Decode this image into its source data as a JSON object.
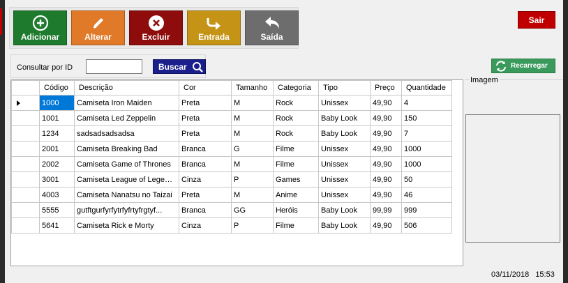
{
  "toolbar": {
    "add_label": "Adicionar",
    "edit_label": "Alterar",
    "delete_label": "Excluir",
    "in_label": "Entrada",
    "out_label": "Saída",
    "exit_label": "Sair"
  },
  "colors": {
    "add": "#1e7b2e",
    "edit": "#e07a28",
    "delete": "#8e0c0c",
    "in": "#c59417",
    "out": "#6d6d6d",
    "exit": "#c00000",
    "search": "#1a1f8c",
    "reload": "#3a9a5c",
    "selection": "#0078d7"
  },
  "icons": {
    "add": "plus-circle-icon",
    "edit": "pencil-icon",
    "delete": "x-circle-icon",
    "in": "arrow-turn-right-icon",
    "out": "arrow-back-icon",
    "search": "search-icon",
    "reload": "refresh-icon"
  },
  "search": {
    "label": "Consultar por ID",
    "value": "",
    "button_label": "Buscar"
  },
  "reload_label": "Recarregar",
  "image_group_label": "Imagem",
  "table": {
    "columns": [
      "Código",
      "Descrição",
      "Cor",
      "Tamanho",
      "Categoria",
      "Tipo",
      "Preço",
      "Quantidade"
    ],
    "selected_row": 0,
    "rows": [
      [
        "1000",
        "Camiseta Iron Maiden",
        "Preta",
        "M",
        "Rock",
        "Unissex",
        "49,90",
        "4"
      ],
      [
        "1001",
        "Camiseta Led Zeppelin",
        "Preta",
        "M",
        "Rock",
        "Baby Look",
        "49,90",
        "150"
      ],
      [
        "1234",
        "sadsadsadsadsa",
        "Preta",
        "M",
        "Rock",
        "Baby Look",
        "49,90",
        "7"
      ],
      [
        "2001",
        "Camiseta Breaking Bad",
        "Branca",
        "G",
        "Filme",
        "Unissex",
        "49,90",
        "1000"
      ],
      [
        "2002",
        "Camiseta Game of Thrones",
        "Branca",
        "M",
        "Filme",
        "Unissex",
        "49,90",
        "1000"
      ],
      [
        "3001",
        "Camiseta League of Legends",
        "Cinza",
        "P",
        "Games",
        "Unissex",
        "49,90",
        "50"
      ],
      [
        "4003",
        "Camiseta Nanatsu no Taizai",
        "Preta",
        "M",
        "Anime",
        "Unissex",
        "49,90",
        "46"
      ],
      [
        "5555",
        "gutftgurfyrfytrfyfrtyfrgtyf...",
        "Branca",
        "GG",
        "Heróis",
        "Baby Look",
        "99,99",
        "999"
      ],
      [
        "5641",
        "Camiseta Rick e Morty",
        "Cinza",
        "P",
        "Filme",
        "Baby Look",
        "49,90",
        "506"
      ]
    ]
  },
  "status": {
    "date": "03/11/2018",
    "time": "15:53"
  }
}
